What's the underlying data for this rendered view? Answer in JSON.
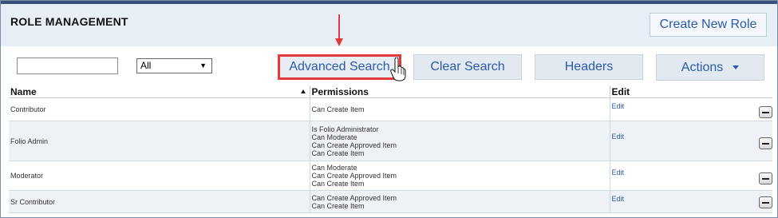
{
  "header": {
    "title": "ROLE MANAGEMENT",
    "create_label": "Create New Role"
  },
  "toolbar": {
    "search_value": "",
    "filter_selected": "All",
    "advanced_label": "Advanced Search",
    "clear_label": "Clear Search",
    "headers_label": "Headers",
    "actions_label": "Actions"
  },
  "table": {
    "columns": [
      "Name",
      "Permissions",
      "Edit"
    ],
    "rows": [
      {
        "name": "Contributor",
        "permissions": [
          "Can Create Item"
        ],
        "edit": "Edit"
      },
      {
        "name": "Folio Admin",
        "permissions": [
          "Is Folio Administrator",
          "Can Moderate",
          "Can Create Approved Item",
          "Can Create Item"
        ],
        "edit": "Edit"
      },
      {
        "name": "Moderator",
        "permissions": [
          "Can Moderate",
          "Can Create Approved Item",
          "Can Create Item"
        ],
        "edit": "Edit"
      },
      {
        "name": "Sr Contributor",
        "permissions": [
          "Can Create Approved Item",
          "Can Create Item"
        ],
        "edit": "Edit"
      }
    ]
  },
  "colors": {
    "accent": "#2a5ba8",
    "highlight": "#e33a3a",
    "header_bg": "#e8eef5"
  }
}
